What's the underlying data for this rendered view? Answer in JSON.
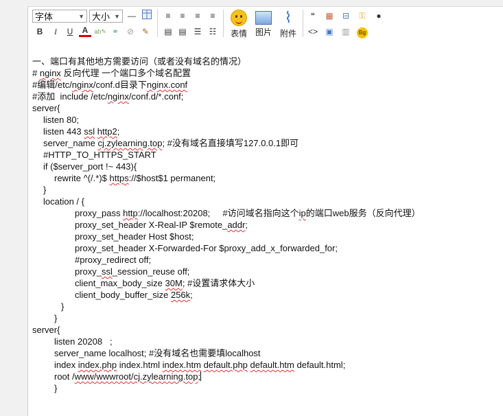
{
  "toolbar": {
    "font_select": "字体",
    "size_select": "大小",
    "emoticon_label": "表情",
    "image_label": "图片",
    "attachment_label": "附件",
    "tag_bg": "Bg"
  },
  "content": {
    "lines": [
      {
        "indent": 0,
        "segments": [
          {
            "t": "一、端口有其他地方需要访问（或者没有域名的情况）"
          }
        ]
      },
      {
        "indent": 0,
        "segments": [
          {
            "t": "# "
          },
          {
            "t": "nginx",
            "sq": true
          },
          {
            "t": " 反向代理 一个端口多个域名配置"
          }
        ]
      },
      {
        "indent": 0,
        "segments": [
          {
            "t": "#编辑/etc/"
          },
          {
            "t": "nginx",
            "sq": true
          },
          {
            "t": "/conf.d目录下"
          },
          {
            "t": "nginx.conf",
            "sq": true
          }
        ]
      },
      {
        "indent": 0,
        "segments": [
          {
            "t": "#添加  include /etc/"
          },
          {
            "t": "nginx",
            "sq": true
          },
          {
            "t": "/conf.d/*.conf;"
          }
        ]
      },
      {
        "indent": 0,
        "segments": [
          {
            "t": "server{"
          }
        ]
      },
      {
        "indent": 1,
        "segments": [
          {
            "t": "listen 80;"
          }
        ]
      },
      {
        "indent": 1,
        "segments": [
          {
            "t": "listen 443 "
          },
          {
            "t": "ssl",
            "sq": true
          },
          {
            "t": " "
          },
          {
            "t": "http2",
            "sq": true
          },
          {
            "t": ";"
          }
        ]
      },
      {
        "indent": 1,
        "segments": [
          {
            "t": "server_name "
          },
          {
            "t": "cj.zylearning.top",
            "sq": true
          },
          {
            "t": "; #没有域名直接填写127.0.0.1即可"
          }
        ]
      },
      {
        "indent": 1,
        "segments": [
          {
            "t": "#HTTP_TO_HTTPS_START"
          }
        ]
      },
      {
        "indent": 1,
        "segments": [
          {
            "t": "if ($server_port !~ 443){"
          }
        ]
      },
      {
        "indent": 2,
        "segments": [
          {
            "t": "rewrite ^(/.*)$ "
          },
          {
            "t": "https",
            "sq": true
          },
          {
            "t": "://$host$1 permanent;"
          }
        ]
      },
      {
        "indent": 1,
        "segments": [
          {
            "t": "}"
          }
        ]
      },
      {
        "indent": 1,
        "segments": [
          {
            "t": "location / {"
          }
        ]
      },
      {
        "indent": 4,
        "segments": [
          {
            "t": "proxy_pass "
          },
          {
            "t": "http",
            "sq": true
          },
          {
            "t": "://localhost:20208;     #访问域名指向这个"
          },
          {
            "t": "ip",
            "sq": true
          },
          {
            "t": "的端口web服务（反向代理）"
          }
        ]
      },
      {
        "indent": 4,
        "segments": [
          {
            "t": "proxy_set_header X-Real-IP $remote_"
          },
          {
            "t": "addr",
            "sq": true
          },
          {
            "t": ";"
          }
        ]
      },
      {
        "indent": 4,
        "segments": [
          {
            "t": "proxy_set_header Host $host;"
          }
        ]
      },
      {
        "indent": 4,
        "segments": [
          {
            "t": "proxy_set_header X-Forwarded-For $proxy_add_x_forwarded_for;"
          }
        ]
      },
      {
        "indent": 4,
        "segments": [
          {
            "t": "#proxy_redirect off;"
          }
        ]
      },
      {
        "indent": 4,
        "segments": [
          {
            "t": "proxy_"
          },
          {
            "t": "ssl",
            "sq": true
          },
          {
            "t": "_session_reuse off;"
          }
        ]
      },
      {
        "indent": 4,
        "segments": [
          {
            "t": "client_max_body_size "
          },
          {
            "t": "30M",
            "sq": true
          },
          {
            "t": "; #设置请求体大小"
          }
        ]
      },
      {
        "indent": 4,
        "segments": [
          {
            "t": "client_body_buffer_size "
          },
          {
            "t": "256k",
            "sq": true
          },
          {
            "t": ";"
          }
        ]
      },
      {
        "indent": 3,
        "segments": [
          {
            "t": "}"
          }
        ]
      },
      {
        "indent": 2,
        "segments": [
          {
            "t": "}"
          }
        ]
      },
      {
        "indent": 0,
        "segments": [
          {
            "t": "server{"
          }
        ]
      },
      {
        "indent": 2,
        "segments": [
          {
            "t": "listen 20208   ;"
          }
        ]
      },
      {
        "indent": 2,
        "segments": [
          {
            "t": "server_name localhost; #没有域名也需要填localhost"
          }
        ]
      },
      {
        "indent": 2,
        "segments": [
          {
            "t": "index "
          },
          {
            "t": "index.php",
            "sq": true
          },
          {
            "t": " index.html "
          },
          {
            "t": "index.htm",
            "sq": true
          },
          {
            "t": " "
          },
          {
            "t": "default.php",
            "sq": true
          },
          {
            "t": " "
          },
          {
            "t": "default.htm",
            "sq": true
          },
          {
            "t": " default.html;"
          }
        ]
      },
      {
        "indent": 2,
        "segments": [
          {
            "t": "root /"
          },
          {
            "t": "www/wwwroot/cj.zylearning.top",
            "sq": true
          },
          {
            "t": ";"
          }
        ],
        "caret": true
      },
      {
        "indent": 2,
        "segments": [
          {
            "t": "}"
          }
        ]
      }
    ]
  }
}
